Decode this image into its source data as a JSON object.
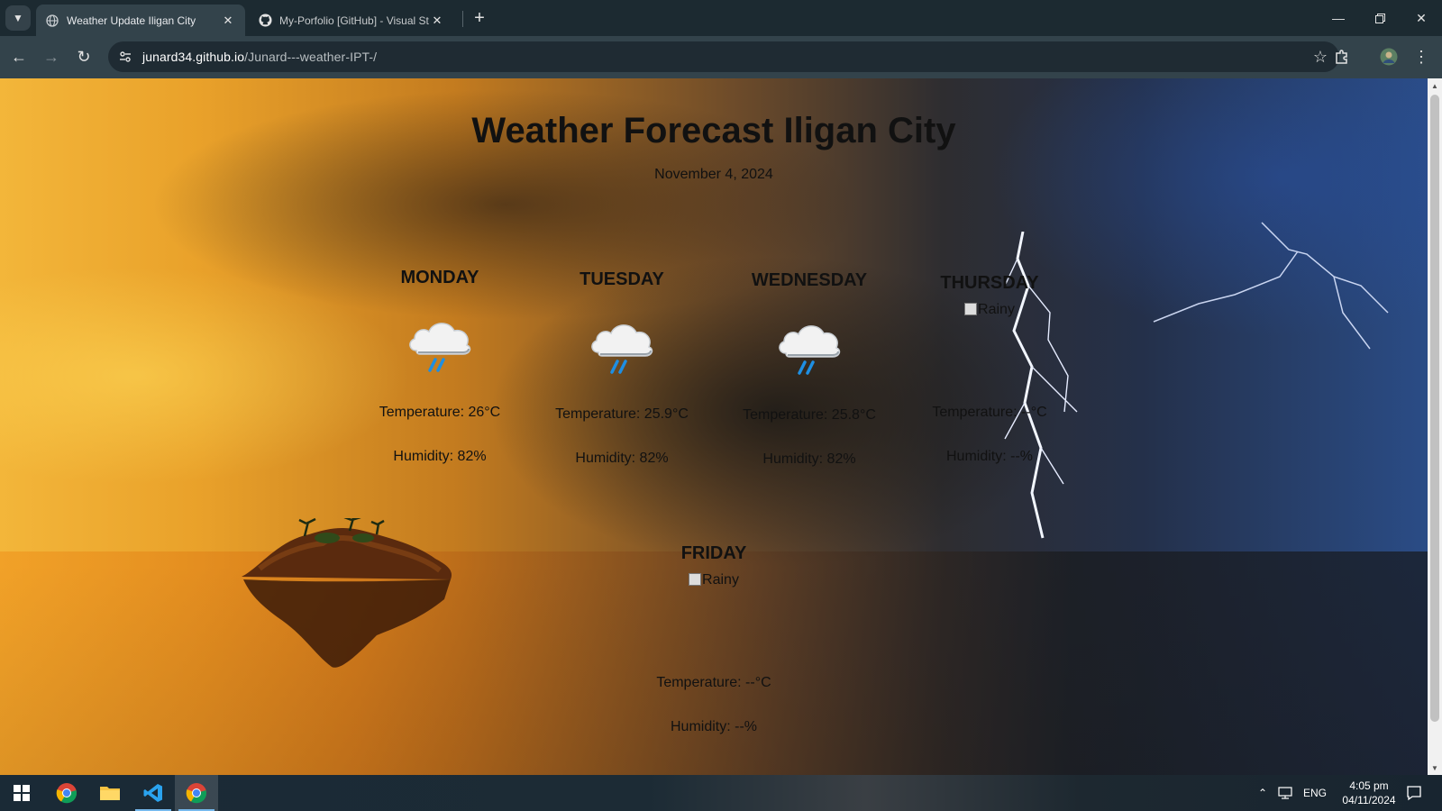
{
  "browser": {
    "tabs": [
      {
        "title": "Weather Update Iligan City",
        "active": true
      },
      {
        "title": "My-Porfolio [GitHub] - Visual St",
        "active": false
      }
    ],
    "url_host": "junard34.github.io",
    "url_path": "/Junard---weather-IPT-/"
  },
  "page": {
    "title": "Weather Forecast Iligan City",
    "date": "November 4, 2024",
    "days": [
      {
        "name": "MONDAY",
        "icon": "rain-cloud-icon",
        "temperature": "Temperature: 26°C",
        "humidity": "Humidity: 82%"
      },
      {
        "name": "TUESDAY",
        "icon": "rain-cloud-icon",
        "temperature": "Temperature: 25.9°C",
        "humidity": "Humidity: 82%"
      },
      {
        "name": "WEDNESDAY",
        "icon": "rain-cloud-icon",
        "temperature": "Temperature: 25.8°C",
        "humidity": "Humidity: 82%"
      },
      {
        "name": "THURSDAY",
        "icon_alt": "Rainy",
        "temperature": "Temperature: --°C",
        "humidity": "Humidity: --%"
      },
      {
        "name": "FRIDAY",
        "icon_alt": "Rainy",
        "temperature": "Temperature: --°C",
        "humidity": "Humidity: --%"
      }
    ]
  },
  "taskbar": {
    "language": "ENG",
    "time": "4:05 pm",
    "date": "04/11/2024"
  }
}
